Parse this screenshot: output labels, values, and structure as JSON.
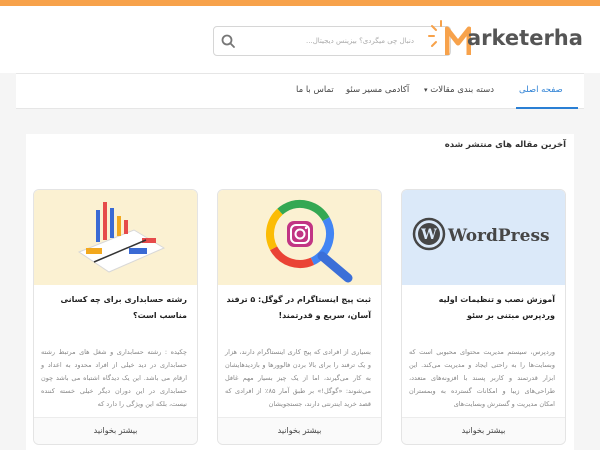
{
  "search": {
    "placeholder": "دنبال چی میگردی؟ بیزینس دیجیتال..."
  },
  "logo": {
    "text": "arketerha",
    "letter": "M"
  },
  "nav": {
    "home": "صفحه اصلی",
    "categories": "دسته بندی مقالات",
    "academy": "آکادمی مسیر سئو",
    "contact": "تماس با ما"
  },
  "section": {
    "title": "آخرین مقاله های منتشر شده"
  },
  "cards": [
    {
      "title": "آموزش نصب و تنظیمات اولیه وردپرس مبتنی بر سئو",
      "excerpt": "وردپرس، سیستم مدیریت محتوای محبوبی است که وبسایت‌ها را به راحتی ایجاد و مدیریت می‌کند. این ابزار قدرتمند و کاربر پسند با افزونه‌های متعدد، طراحی‌های زیبا و امکانات گسترده به وبمستران امکان مدیریت و گسترش وبسایت‌های",
      "more": "بیشتر بخوانید",
      "thumb_text": "WordPress",
      "thumb_bg": "#dbe9f9"
    },
    {
      "title": "ثبت پیج اینستاگرام در گوگل: ۵ ترفند آسان، سریع و قدرتمند!",
      "excerpt": "بسیاری از افرادی که پیج کاری اینستاگرام دارند، هزار و یک ترفند را برای بالا بردن فالوورها و بازدیدهایشان به کار می‌گیرند، اما از یک چیز بسیار مهم غافل می‌شوند: «گوگل!» بر طبق آمار ۸۵٪ از افرادی که قصد خرید اینترنتی دارند، جستجویشان",
      "more": "بیشتر بخوانید",
      "thumb_bg": "#fbf1d2"
    },
    {
      "title": "رشته حسابداری برای چه کسانی مناسب است؟",
      "excerpt": "چکیده : رشته حسابداری و شغل های مرتبط رشته حسابداری در دید خیلی از افراد محدود به اعداد و ارقام می باشد. این یک دیدگاه اشتباه می باشد چون حسابداری در این دوران دیگر خیلی خسته کننده نیست، بلکه این ویژگی را دارد که",
      "more": "بیشتر بخوانید",
      "thumb_bg": "#fbf1d2"
    }
  ],
  "colors": {
    "accent": "#2a7fd4",
    "brand_orange": "#f7a24b"
  }
}
